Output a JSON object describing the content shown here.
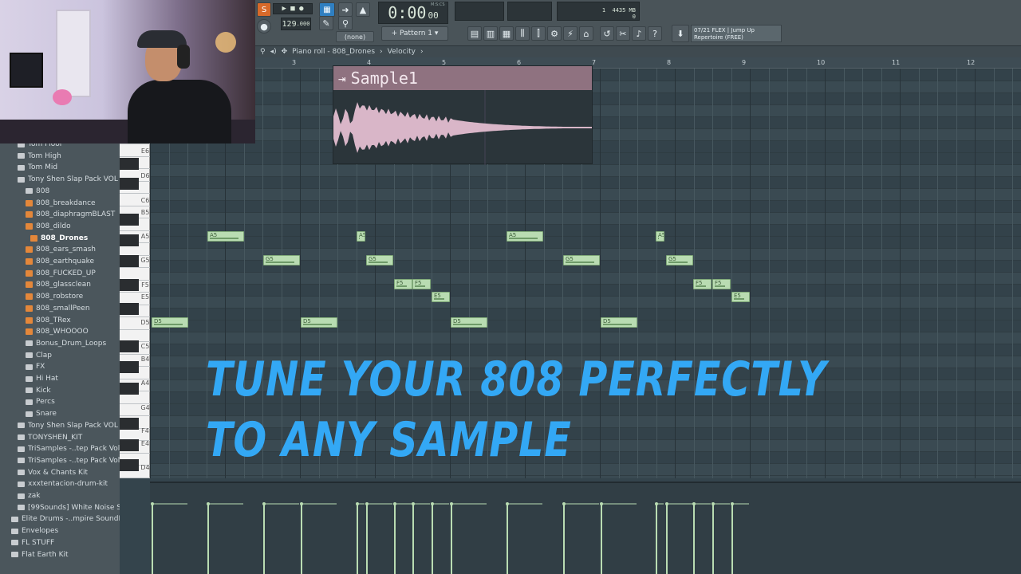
{
  "toolbar": {
    "pat_song": "S",
    "tempo": "129",
    "tempo_dec": ".000",
    "time_display": "0:00",
    "time_sub": "00",
    "time_hint": "M:S:CS",
    "pattern_label": "Pattern 1",
    "snap_label": "(none)",
    "cpu_count": "1",
    "memory": "4435 MB",
    "poly": "0",
    "news_counter": "07/21",
    "news_title": "FLEX | Jump Up",
    "news_sub": "Repertoire (FREE)"
  },
  "breadcrumb": {
    "piano_roll": "Piano roll - 808_Drones",
    "separator": "›",
    "target": "Velocity",
    "end_arrow": "›"
  },
  "ruler": [
    "3",
    "4",
    "5",
    "6",
    "7",
    "8",
    "9",
    "10",
    "11",
    "12"
  ],
  "sample_popup": {
    "title": "Sample1",
    "icon": "arrow-icon"
  },
  "overlay": {
    "line1": "TUNE YOUR 808 PERFECTLY",
    "line2": "TO ANY SAMPLE"
  },
  "keyboard": [
    "E6",
    "D6",
    "C6",
    "B5",
    "A5",
    "G5",
    "F5",
    "E5",
    "D5",
    "C5",
    "B4",
    "A4",
    "G4",
    "F4",
    "E4",
    "D4"
  ],
  "browser": {
    "items": [
      {
        "label": "Tom Floor",
        "type": "folder"
      },
      {
        "label": "Tom High",
        "type": "folder"
      },
      {
        "label": "Tom Mid",
        "type": "folder"
      },
      {
        "label": "Tony Shen Slap Pack VOL 1",
        "type": "folder"
      },
      {
        "label": "808",
        "type": "folder"
      },
      {
        "label": "808_breakdance",
        "type": "sample"
      },
      {
        "label": "808_diaphragmBLAST",
        "type": "sample"
      },
      {
        "label": "808_dildo",
        "type": "sample"
      },
      {
        "label": "808_Drones",
        "type": "sample"
      },
      {
        "label": "808_ears_smash",
        "type": "sample"
      },
      {
        "label": "808_earthquake",
        "type": "sample"
      },
      {
        "label": "808_FUCKED_UP",
        "type": "sample"
      },
      {
        "label": "808_glassclean",
        "type": "sample"
      },
      {
        "label": "808_robstore",
        "type": "sample"
      },
      {
        "label": "808_smallPeen",
        "type": "sample"
      },
      {
        "label": "808_TRex",
        "type": "sample"
      },
      {
        "label": "808_WHOOOO",
        "type": "sample"
      },
      {
        "label": "Bonus_Drum_Loops",
        "type": "folder"
      },
      {
        "label": "Clap",
        "type": "folder"
      },
      {
        "label": "FX",
        "type": "folder"
      },
      {
        "label": "Hi Hat",
        "type": "folder"
      },
      {
        "label": "Kick",
        "type": "folder"
      },
      {
        "label": "Percs",
        "type": "folder"
      },
      {
        "label": "Snare",
        "type": "folder"
      },
      {
        "label": "Tony Shen Slap Pack VOL 2",
        "type": "folder"
      },
      {
        "label": "TONYSHEN_KIT",
        "type": "folder"
      },
      {
        "label": "TriSamples -..tep Pack Vol 1",
        "type": "folder"
      },
      {
        "label": "TriSamples -..tep Pack Vol 2",
        "type": "folder"
      },
      {
        "label": "Vox & Chants Kit",
        "type": "folder"
      },
      {
        "label": "xxxtentacion-drum-kit",
        "type": "folder"
      },
      {
        "label": "zak",
        "type": "folder"
      },
      {
        "label": "[99Sounds] White Noise SFX",
        "type": "folder"
      },
      {
        "label": "Elite Drums -..mpire SoundKits",
        "type": "folder"
      },
      {
        "label": "Envelopes",
        "type": "folder"
      },
      {
        "label": "FL STUFF",
        "type": "folder"
      },
      {
        "label": "Flat Earth Kit",
        "type": "folder"
      }
    ]
  },
  "notes": [
    {
      "label": "D5"
    },
    {
      "label": "A5"
    },
    {
      "label": "G5"
    },
    {
      "label": "D5"
    },
    {
      "label": "A5"
    },
    {
      "label": "G5"
    },
    {
      "label": "F5"
    },
    {
      "label": "F5"
    },
    {
      "label": "E5"
    },
    {
      "label": "D5"
    },
    {
      "label": "A5"
    },
    {
      "label": "G5"
    },
    {
      "label": "D5"
    },
    {
      "label": "A5"
    },
    {
      "label": "G5"
    },
    {
      "label": "F5"
    },
    {
      "label": "F5"
    },
    {
      "label": "E5"
    }
  ]
}
